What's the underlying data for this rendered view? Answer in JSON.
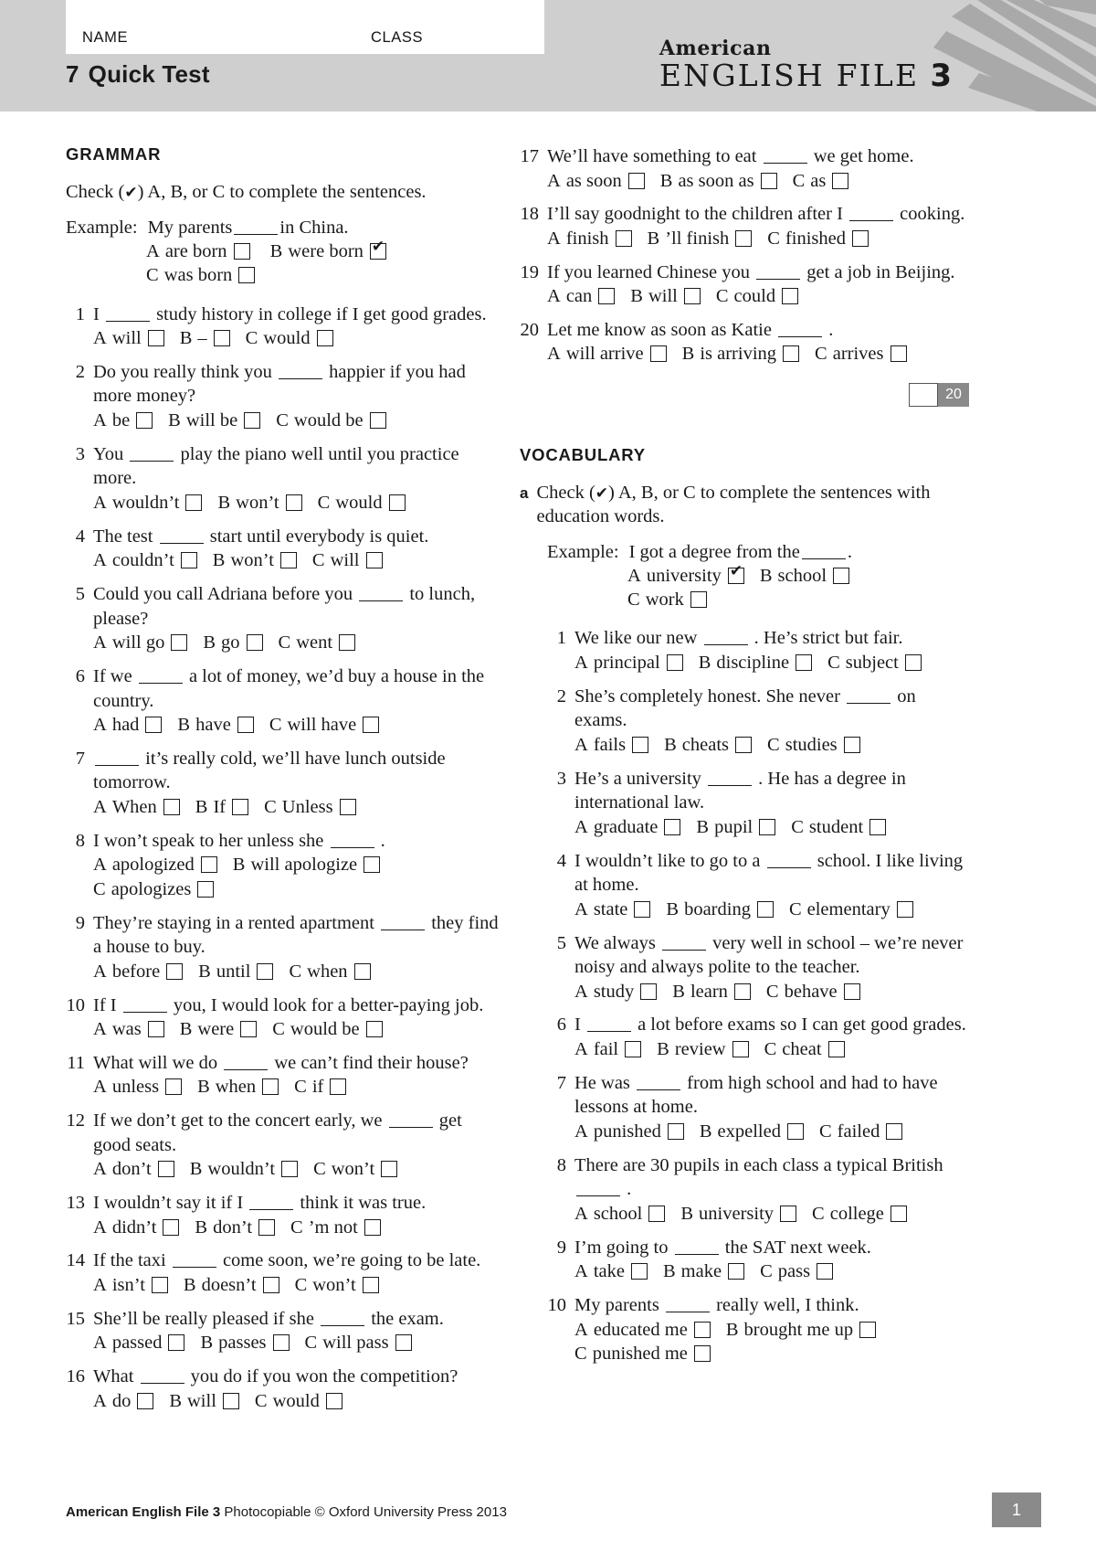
{
  "header": {
    "name_label": "NAME",
    "class_label": "CLASS",
    "unit_number": "7",
    "test_title": "Quick Test",
    "brand_line1": "American",
    "brand_line2": "ENGLISH FILE",
    "brand_level": "3"
  },
  "grammar": {
    "heading": "GRAMMAR",
    "rubric_pre": "Check (",
    "rubric_tick": "✔",
    "rubric_post": ") A, B, or C to complete the sentences.",
    "example": {
      "label": "Example:",
      "stem_pre": "My parents",
      "stem_post": "in China.",
      "options": [
        {
          "letter": "A",
          "text": "are born",
          "checked": false
        },
        {
          "letter": "B",
          "text": "were born",
          "checked": true
        },
        {
          "letter": "C",
          "text": "was born",
          "checked": false
        }
      ]
    },
    "score_value": "20",
    "questions": [
      {
        "num": "1",
        "stem_pre": "I",
        "stem_post": "study history in college if I get good grades.",
        "options": [
          {
            "letter": "A",
            "text": "will"
          },
          {
            "letter": "B",
            "text": "–"
          },
          {
            "letter": "C",
            "text": "would"
          }
        ]
      },
      {
        "num": "2",
        "stem_pre": "Do you really think you",
        "stem_post": "happier if you had more money?",
        "options": [
          {
            "letter": "A",
            "text": "be"
          },
          {
            "letter": "B",
            "text": "will be"
          },
          {
            "letter": "C",
            "text": "would be"
          }
        ]
      },
      {
        "num": "3",
        "stem_pre": "You",
        "stem_post": "play the piano well until you practice more.",
        "options": [
          {
            "letter": "A",
            "text": "wouldn’t"
          },
          {
            "letter": "B",
            "text": "won’t"
          },
          {
            "letter": "C",
            "text": "would"
          }
        ]
      },
      {
        "num": "4",
        "stem_pre": "The test",
        "stem_post": "start until everybody is quiet.",
        "options": [
          {
            "letter": "A",
            "text": "couldn’t"
          },
          {
            "letter": "B",
            "text": "won’t"
          },
          {
            "letter": "C",
            "text": "will"
          }
        ]
      },
      {
        "num": "5",
        "stem_pre": "Could you call Adriana before you",
        "stem_post": "to lunch, please?",
        "options": [
          {
            "letter": "A",
            "text": "will go"
          },
          {
            "letter": "B",
            "text": "go"
          },
          {
            "letter": "C",
            "text": "went"
          }
        ]
      },
      {
        "num": "6",
        "stem_pre": "If we",
        "stem_post": "a lot of money, we’d buy a house in the country.",
        "options": [
          {
            "letter": "A",
            "text": "had"
          },
          {
            "letter": "B",
            "text": "have"
          },
          {
            "letter": "C",
            "text": "will have"
          }
        ]
      },
      {
        "num": "7",
        "stem_pre": "",
        "stem_post": "it’s really cold, we’ll have lunch outside tomorrow.",
        "options": [
          {
            "letter": "A",
            "text": "When"
          },
          {
            "letter": "B",
            "text": "If"
          },
          {
            "letter": "C",
            "text": "Unless"
          }
        ]
      },
      {
        "num": "8",
        "stem_pre": "I won’t speak to her unless she",
        "stem_post": ".",
        "options": [
          {
            "letter": "A",
            "text": "apologized"
          },
          {
            "letter": "B",
            "text": "will apologize"
          },
          {
            "letter": "C",
            "text": "apologizes"
          }
        ]
      },
      {
        "num": "9",
        "stem_pre": "They’re staying in a rented apartment",
        "stem_post": "they find a house to buy.",
        "options": [
          {
            "letter": "A",
            "text": "before"
          },
          {
            "letter": "B",
            "text": "until"
          },
          {
            "letter": "C",
            "text": "when"
          }
        ]
      },
      {
        "num": "10",
        "stem_pre": "If I",
        "stem_post": "you, I would look for a better-paying job.",
        "options": [
          {
            "letter": "A",
            "text": "was"
          },
          {
            "letter": "B",
            "text": "were"
          },
          {
            "letter": "C",
            "text": "would be"
          }
        ]
      },
      {
        "num": "11",
        "stem_pre": "What will we do",
        "stem_post": "we can’t find their house?",
        "options": [
          {
            "letter": "A",
            "text": "unless"
          },
          {
            "letter": "B",
            "text": "when"
          },
          {
            "letter": "C",
            "text": "if"
          }
        ]
      },
      {
        "num": "12",
        "stem_pre": "If we don’t get to the concert early, we",
        "stem_post": "get good seats.",
        "options": [
          {
            "letter": "A",
            "text": "don’t"
          },
          {
            "letter": "B",
            "text": "wouldn’t"
          },
          {
            "letter": "C",
            "text": "won’t"
          }
        ]
      },
      {
        "num": "13",
        "stem_pre": "I wouldn’t say it if I",
        "stem_post": "think it was true.",
        "options": [
          {
            "letter": "A",
            "text": "didn’t"
          },
          {
            "letter": "B",
            "text": "don’t"
          },
          {
            "letter": "C",
            "text": "’m not"
          }
        ]
      },
      {
        "num": "14",
        "stem_pre": "If the taxi",
        "stem_post": "come soon, we’re going to be late.",
        "options": [
          {
            "letter": "A",
            "text": "isn’t"
          },
          {
            "letter": "B",
            "text": "doesn’t"
          },
          {
            "letter": "C",
            "text": "won’t"
          }
        ]
      },
      {
        "num": "15",
        "stem_pre": "She’ll be really pleased if she",
        "stem_post": "the exam.",
        "options": [
          {
            "letter": "A",
            "text": "passed"
          },
          {
            "letter": "B",
            "text": "passes"
          },
          {
            "letter": "C",
            "text": "will pass"
          }
        ]
      },
      {
        "num": "16",
        "stem_pre": "What",
        "stem_post": "you do if you won the competition?",
        "options": [
          {
            "letter": "A",
            "text": "do"
          },
          {
            "letter": "B",
            "text": "will"
          },
          {
            "letter": "C",
            "text": "would"
          }
        ]
      },
      {
        "num": "17",
        "stem_pre": "We’ll have something to eat",
        "stem_post": "we get home.",
        "options": [
          {
            "letter": "A",
            "text": "as soon"
          },
          {
            "letter": "B",
            "text": "as soon as"
          },
          {
            "letter": "C",
            "text": "as"
          }
        ]
      },
      {
        "num": "18",
        "stem_pre": "I’ll say goodnight to the children after I",
        "stem_post": "cooking.",
        "options": [
          {
            "letter": "A",
            "text": "finish"
          },
          {
            "letter": "B",
            "text": "’ll finish"
          },
          {
            "letter": "C",
            "text": "finished"
          }
        ]
      },
      {
        "num": "19",
        "stem_pre": "If you learned Chinese you",
        "stem_post": "get a job in Beijing.",
        "options": [
          {
            "letter": "A",
            "text": "can"
          },
          {
            "letter": "B",
            "text": "will"
          },
          {
            "letter": "C",
            "text": "could"
          }
        ]
      },
      {
        "num": "20",
        "stem_pre": "Let me know as soon as Katie",
        "stem_post": ".",
        "options": [
          {
            "letter": "A",
            "text": "will arrive"
          },
          {
            "letter": "B",
            "text": "is arriving"
          },
          {
            "letter": "C",
            "text": "arrives"
          }
        ]
      }
    ]
  },
  "vocabulary": {
    "heading": "VOCABULARY",
    "part_letter": "a",
    "rubric_pre": "Check (",
    "rubric_tick": "✔",
    "rubric_post": ") A, B, or C to complete the sentences with education words.",
    "example": {
      "label": "Example:",
      "stem_pre": "I got a degree from the",
      "stem_post": ".",
      "options": [
        {
          "letter": "A",
          "text": "university",
          "checked": true
        },
        {
          "letter": "B",
          "text": "school",
          "checked": false
        },
        {
          "letter": "C",
          "text": "work",
          "checked": false
        }
      ]
    },
    "questions": [
      {
        "num": "1",
        "stem_pre": "We like our new",
        "stem_post": ". He’s strict but fair.",
        "options": [
          {
            "letter": "A",
            "text": "principal"
          },
          {
            "letter": "B",
            "text": "discipline"
          },
          {
            "letter": "C",
            "text": "subject"
          }
        ]
      },
      {
        "num": "2",
        "stem_pre": "She’s completely honest. She never",
        "stem_post": "on exams.",
        "options": [
          {
            "letter": "A",
            "text": "fails"
          },
          {
            "letter": "B",
            "text": "cheats"
          },
          {
            "letter": "C",
            "text": "studies"
          }
        ]
      },
      {
        "num": "3",
        "stem_pre": "He’s a university",
        "stem_post": ". He has a degree in international law.",
        "options": [
          {
            "letter": "A",
            "text": "graduate"
          },
          {
            "letter": "B",
            "text": "pupil"
          },
          {
            "letter": "C",
            "text": "student"
          }
        ]
      },
      {
        "num": "4",
        "stem_pre": "I wouldn’t like to go to a",
        "stem_post": "school. I like living at home.",
        "options": [
          {
            "letter": "A",
            "text": "state"
          },
          {
            "letter": "B",
            "text": "boarding"
          },
          {
            "letter": "C",
            "text": "elementary"
          }
        ]
      },
      {
        "num": "5",
        "stem_pre": "We always",
        "stem_post": "very well in school – we’re never noisy and always polite to the teacher.",
        "options": [
          {
            "letter": "A",
            "text": "study"
          },
          {
            "letter": "B",
            "text": "learn"
          },
          {
            "letter": "C",
            "text": "behave"
          }
        ]
      },
      {
        "num": "6",
        "stem_pre": "I",
        "stem_post": "a lot before exams so I can get good grades.",
        "options": [
          {
            "letter": "A",
            "text": "fail"
          },
          {
            "letter": "B",
            "text": "review"
          },
          {
            "letter": "C",
            "text": "cheat"
          }
        ]
      },
      {
        "num": "7",
        "stem_pre": "He was",
        "stem_post": "from high school and had to have lessons at home.",
        "options": [
          {
            "letter": "A",
            "text": "punished"
          },
          {
            "letter": "B",
            "text": "expelled"
          },
          {
            "letter": "C",
            "text": "failed"
          }
        ]
      },
      {
        "num": "8",
        "stem_pre": "There are 30 pupils in each class a typical British",
        "stem_post": ".",
        "options": [
          {
            "letter": "A",
            "text": "school"
          },
          {
            "letter": "B",
            "text": "university"
          },
          {
            "letter": "C",
            "text": "college"
          }
        ]
      },
      {
        "num": "9",
        "stem_pre": "I’m going to",
        "stem_post": "the SAT next week.",
        "options": [
          {
            "letter": "A",
            "text": "take"
          },
          {
            "letter": "B",
            "text": "make"
          },
          {
            "letter": "C",
            "text": "pass"
          }
        ]
      },
      {
        "num": "10",
        "stem_pre": "My parents",
        "stem_post": "really well, I think.",
        "options": [
          {
            "letter": "A",
            "text": "educated me"
          },
          {
            "letter": "B",
            "text": "brought me up"
          },
          {
            "letter": "C",
            "text": "punished me"
          }
        ]
      }
    ]
  },
  "footer": {
    "title": "American English File 3",
    "credit": "Photocopiable © Oxford University Press 2013",
    "page": "1"
  },
  "colors": {
    "header_bg": "#cfcfcf",
    "ray": "#a9a9a9",
    "score_bg": "#8a8a8a",
    "text": "#1a1a1a"
  }
}
